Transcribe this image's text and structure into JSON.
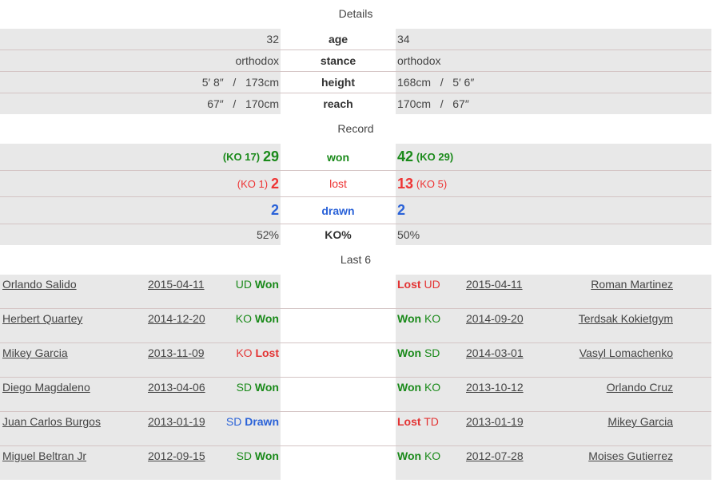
{
  "sections": {
    "details": "Details",
    "record": "Record",
    "last6": "Last 6"
  },
  "details": [
    {
      "left": "32",
      "label": "age",
      "right": "34"
    },
    {
      "left": "orthodox",
      "label": "stance",
      "right": "orthodox"
    },
    {
      "left": "5′ 8″   /   173cm",
      "label": "height",
      "right": "168cm   /   5′ 6″"
    },
    {
      "left": "67″   /   170cm",
      "label": "reach",
      "right": "170cm   /   67″"
    }
  ],
  "record": {
    "won": {
      "label": "won",
      "left_ko": "(KO 17)",
      "left": "29",
      "right": "42",
      "right_ko": "(KO 29)"
    },
    "lost": {
      "label": "lost",
      "left_ko": "(KO 1)",
      "left": "2",
      "right": "13",
      "right_ko": "(KO 5)"
    },
    "drawn": {
      "label": "drawn",
      "left": "2",
      "right": "2"
    },
    "ko_pct": {
      "label": "KO%",
      "left": "52%",
      "right": "50%"
    }
  },
  "colors": {
    "won": "#1a8a1a",
    "lost": "#e33333",
    "drawn": "#2a62d8"
  },
  "last6": {
    "left": [
      {
        "opponent": "Orlando Salido",
        "date": "2015-04-11",
        "method": "UD",
        "result": "Won"
      },
      {
        "opponent": "Herbert Quartey",
        "date": "2014-12-20",
        "method": "KO",
        "result": "Won"
      },
      {
        "opponent": "Mikey Garcia",
        "date": "2013-11-09",
        "method": "KO",
        "result": "Lost"
      },
      {
        "opponent": "Diego Magdaleno",
        "date": "2013-04-06",
        "method": "SD",
        "result": "Won"
      },
      {
        "opponent": "Juan Carlos Burgos",
        "date": "2013-01-19",
        "method": "SD",
        "result": "Drawn"
      },
      {
        "opponent": "Miguel Beltran Jr",
        "date": "2012-09-15",
        "method": "SD",
        "result": "Won"
      }
    ],
    "right": [
      {
        "result": "Lost",
        "method": "UD",
        "date": "2015-04-11",
        "opponent": "Roman Martinez"
      },
      {
        "result": "Won",
        "method": "KO",
        "date": "2014-09-20",
        "opponent": "Terdsak Kokietgym"
      },
      {
        "result": "Won",
        "method": "SD",
        "date": "2014-03-01",
        "opponent": "Vasyl Lomachenko"
      },
      {
        "result": "Won",
        "method": "KO",
        "date": "2013-10-12",
        "opponent": "Orlando Cruz"
      },
      {
        "result": "Lost",
        "method": "TD",
        "date": "2013-01-19",
        "opponent": "Mikey Garcia"
      },
      {
        "result": "Won",
        "method": "KO",
        "date": "2012-07-28",
        "opponent": "Moises Gutierrez"
      }
    ]
  }
}
